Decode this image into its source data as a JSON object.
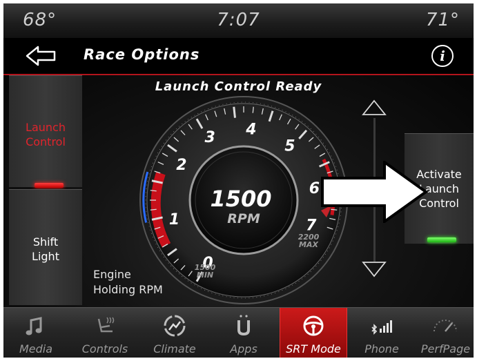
{
  "status_bar": {
    "left_temp": "68°",
    "time": "7:07",
    "right_temp": "71°"
  },
  "header": {
    "title": "Race Options",
    "back_icon": "arrow-left-icon",
    "info_icon": "info-icon",
    "info_glyph": "i"
  },
  "banner": "Launch Control Ready",
  "buttons": {
    "launch_control": {
      "line1": "Launch",
      "line2": "Control",
      "indicator": "red"
    },
    "shift_light": {
      "line1": "Shift",
      "line2": "Light"
    },
    "activate_launch_control": {
      "line1": "Activate",
      "line2": "Launch",
      "line3": "Control",
      "indicator": "green"
    }
  },
  "gauge": {
    "value": "1500",
    "unit": "RPM",
    "ticks": [
      "0",
      "1",
      "2",
      "3",
      "4",
      "5",
      "6",
      "7"
    ],
    "min_label_value": "1500",
    "min_label_text": "MIN",
    "max_label_value": "2200",
    "max_label_text": "MAX"
  },
  "engine_holding": {
    "line1": "Engine",
    "line2": "Holding RPM"
  },
  "nav": {
    "items": [
      {
        "label": "Media",
        "icon": "music-note-icon",
        "active": false
      },
      {
        "label": "Controls",
        "icon": "seat-controls-icon",
        "active": false
      },
      {
        "label": "Climate",
        "icon": "climate-icon",
        "active": false
      },
      {
        "label": "Apps",
        "icon": "apps-icon",
        "active": false
      },
      {
        "label": "SRT Mode",
        "icon": "steering-wheel-icon",
        "active": true
      },
      {
        "label": "Phone",
        "icon": "phone-signal-icon",
        "active": false
      },
      {
        "label": "PerfPage",
        "icon": "performance-gauge-icon",
        "active": false
      }
    ]
  },
  "colors": {
    "accent_red": "#b3141c",
    "indicator_red": "#ff2020",
    "indicator_green": "#40ff30",
    "gauge_needle_blue": "#2a6cff"
  }
}
